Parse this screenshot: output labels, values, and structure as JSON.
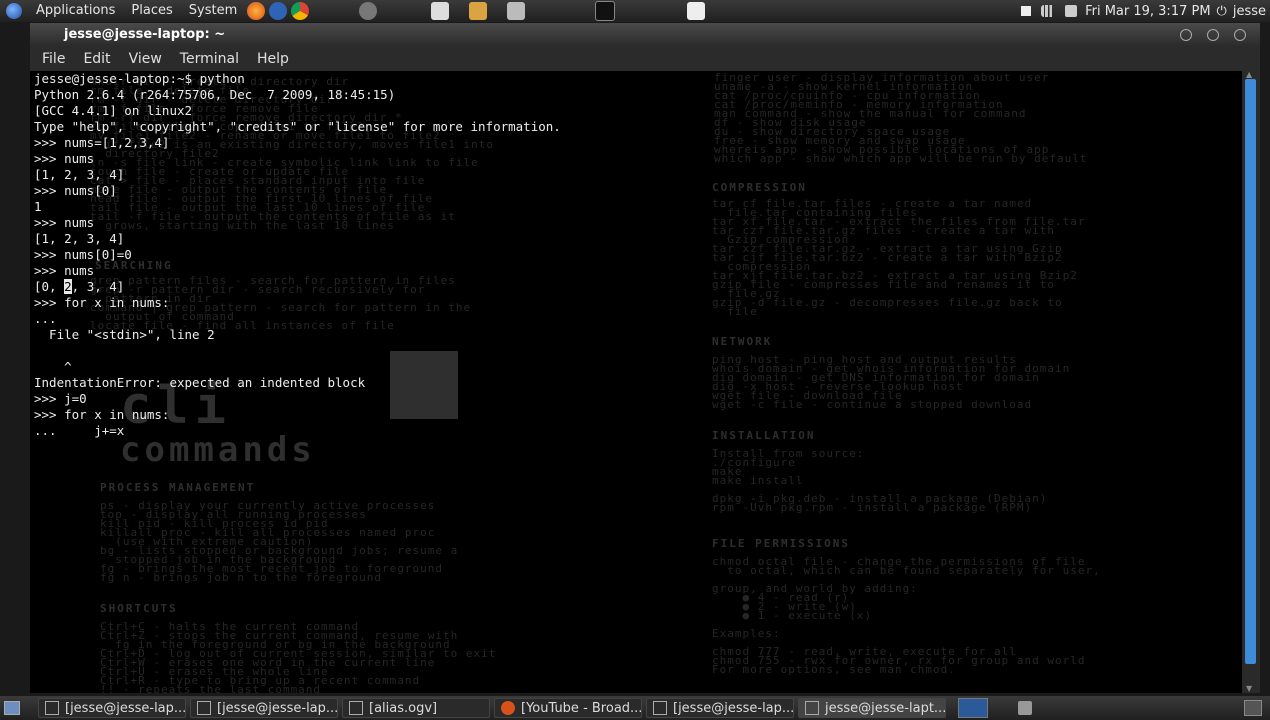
{
  "top_panel": {
    "menus": [
      "Applications",
      "Places",
      "System"
    ],
    "clock": "Fri Mar 19,  3:17 PM",
    "user": "jesse"
  },
  "window": {
    "title": "jesse@jesse-laptop: ~",
    "menu": [
      "File",
      "Edit",
      "View",
      "Terminal",
      "Help"
    ]
  },
  "terminal": {
    "lines": [
      "jesse@jesse-laptop:~$ python",
      "Python 2.6.4 (r264:75706, Dec  7 2009, 18:45:15)",
      "[GCC 4.4.1] on linux2",
      "Type \"help\", \"copyright\", \"credits\" or \"license\" for more information.",
      ">>> nums=[1,2,3,4]",
      ">>> nums",
      "[1, 2, 3, 4]",
      ">>> nums[0]",
      "1",
      ">>> nums",
      "[1, 2, 3, 4]",
      ">>> nums[0]=0",
      ">>> nums",
      "[0, 2, 3, 4]",
      ">>> for x in nums:",
      "...",
      "  File \"<stdin>\", line 2",
      "",
      "    ^",
      "IndentationError: expected an indented block",
      ">>> j=0",
      ">>> for x in nums:",
      "...     j+=x"
    ]
  },
  "wallpaper": {
    "logo_big": "cli",
    "logo_small": "commands",
    "sections": {
      "compression": "COMPRESSION",
      "network": "NETWORK",
      "installation": "INSTALLATION",
      "file_permissions": "FILE PERMISSIONS",
      "process_management": "PROCESS MANAGEMENT",
      "shortcuts": "SHORTCUTS",
      "searching": "SEARCHING"
    },
    "left_top": "mkdir dir - create a directory dir\nrm file - delete file\nrm -r dir - delete directory dir\nrm -f file - force remove file\nrm -rf dir - force remove directory dir *\ncp file1 file2 - copy file1 to file2\nmv file1 file2 - rename or move file1 to file2\n  if file2 is an existing directory, moves file1 into\n  directory file2\nln -s file link - create symbolic link link to file\ntouch file - create or update file\ncat > file - places standard input into file\nmore file - output the contents of file\nhead file - output the first 10 lines of file\ntail file - output the last 10 lines of file\ntail -f file - output the contents of file as it\n  grows, starting with the last 10 lines",
    "left_search": "grep pattern files - search for pattern in files\ngrep -r pattern dir - search recursively for\n  pattern in dir\ncommand | grep pattern - search for pattern in the\n  output of command\nlocate file - find all instances of file",
    "left_process": "ps - display your currently active processes\ntop - display all running processes\nkill pid - kill process id pid\nkillall proc - kill all processes named proc\n  (use with extreme caution)\nbg - lists stopped or background jobs; resume a\n  stopped job in the background\nfg - brings the most recent job to foreground\nfg n - brings job n to the foreground",
    "left_shortcuts": "Ctrl+C - halts the current command\nCtrl+Z - stops the current command, resume with\n  fg in the foreground or bg in the background\nCtrl+D - log out of current session, similar to exit\nCtrl+W - erases one word in the current line\nCtrl+U - erases the whole line\nCtrl+R - type to bring up a recent command\n!! - repeats the last command",
    "right_top": "finger user - display information about user\nuname -a - show kernel information\ncat /proc/cpuinfo - cpu information\ncat /proc/meminfo - memory information\nman command - show the manual for command\ndf - show disk usage\ndu - show directory space usage\nfree - show memory and swap usage\nwhereis app - show possible locations of app\nwhich app - show which app will be run by default",
    "right_compression": "tar cf file.tar files - create a tar named\n  file.tar containing files\ntar xf file.tar - extract the files from file.tar\ntar czf file.tar.gz files - create a tar with\n  Gzip compression\ntar xzf file.tar.gz - extract a tar using Gzip\ntar cjf file.tar.bz2 - create a tar with Bzip2\n  compression\ntar xjf file.tar.bz2 - extract a tar using Bzip2\ngzip file - compresses file and renames it to\n  file.gz\ngzip -d file.gz - decompresses file.gz back to\n  file",
    "right_network": "ping host - ping host and output results\nwhois domain - get whois information for domain\ndig domain - get DNS information for domain\ndig -x host - reverse lookup host\nwget file - download file\nwget -c file - continue a stopped download",
    "right_install": "Install from source:\n./configure\nmake\nmake install\n\ndpkg -i pkg.deb - install a package (Debian)\nrpm -Uvh pkg.rpm - install a package (RPM)",
    "right_perms": "chmod octal file - change the permissions of file\n  to octal, which can be found separately for user,\n\ngroup, and world by adding:\n    ● 4 - read (r)\n    ● 2 - write (w)\n    ● 1 - execute (x)\n\nExamples:\n\nchmod 777 - read, write, execute for all\nchmod 755 - rwx for owner, rx for group and world\nFor more options, see man chmod."
  },
  "taskbar": {
    "tasks": [
      {
        "label": "[jesse@jesse-lap..."
      },
      {
        "label": "[jesse@jesse-lap..."
      },
      {
        "label": "[alias.ogv]"
      },
      {
        "label": "[YouTube - Broad..."
      },
      {
        "label": "[jesse@jesse-lap..."
      },
      {
        "label": "jesse@jesse-lapt..."
      }
    ]
  },
  "colors": {
    "scroll_thumb": "#3d8bd9",
    "terminal_bg": "#000000",
    "terminal_fg": "#ededed"
  }
}
